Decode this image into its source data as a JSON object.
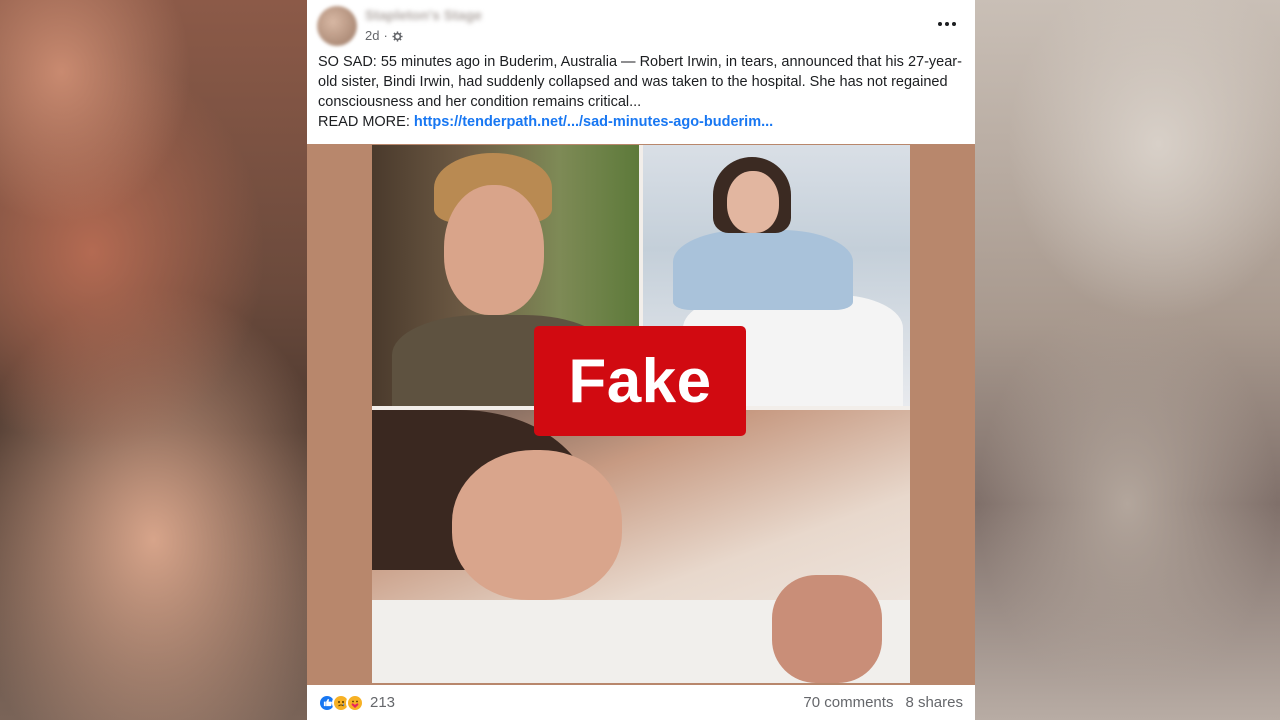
{
  "post": {
    "author": "Stapleton's Stage",
    "time": "2d",
    "audience_icon": "gear-icon",
    "body": "SO SAD: 55 minutes ago in Buderim, Australia — Robert Irwin, in tears, announced that his 27-year-old sister, Bindi Irwin, had suddenly collapsed and was taken to the hospital. She has not regained consciousness and her condition remains critical...",
    "read_more_label": "READ MORE:",
    "link_text": "https://tenderpath.net/.../sad-minutes-ago-buderim..."
  },
  "stamp": {
    "label": "Fake",
    "color": "#d10a11"
  },
  "footer": {
    "reactions": [
      "like-icon",
      "sad-icon",
      "care-icon"
    ],
    "reaction_count": "213",
    "comments": "70 comments",
    "shares": "8 shares"
  },
  "colors": {
    "link": "#1877f2",
    "media_bg": "#b8876c"
  }
}
